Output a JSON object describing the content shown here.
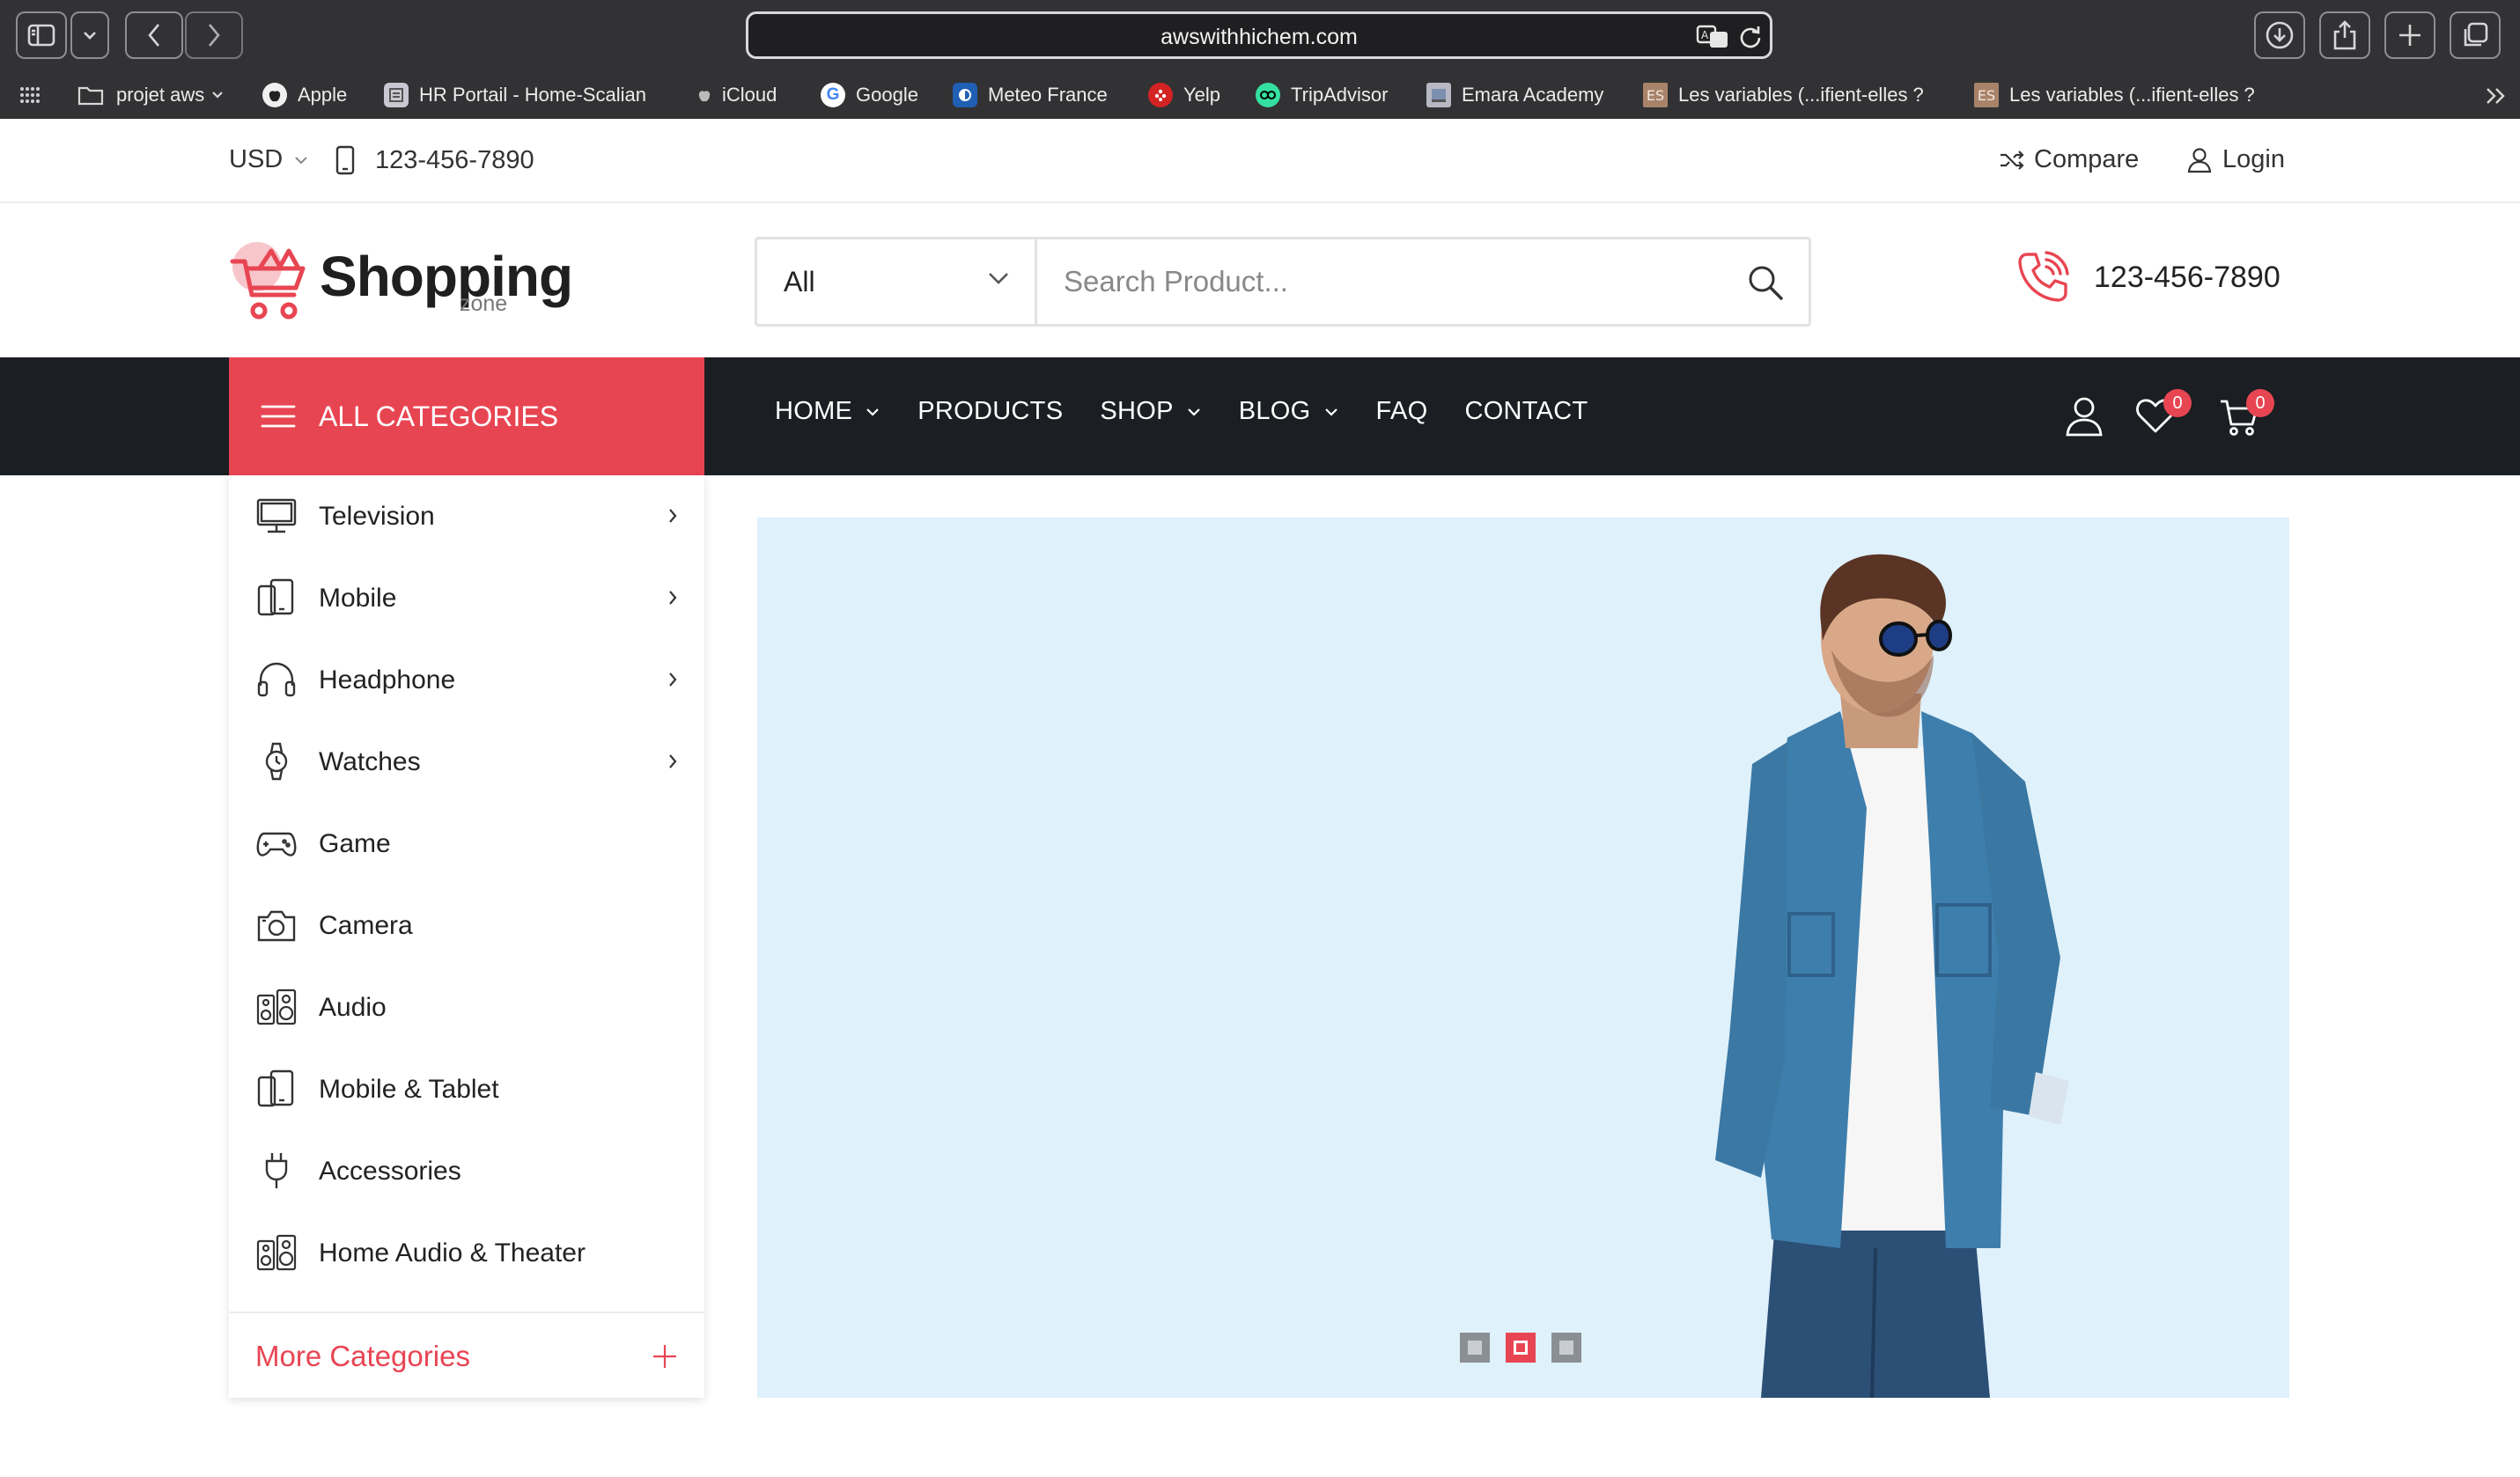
{
  "browser": {
    "url": "awswithhichem.com",
    "bookmarks": [
      {
        "label": "projet aws",
        "icon": "folder-icon"
      },
      {
        "label": "Apple",
        "icon": "apple-icon"
      },
      {
        "label": "HR Portail - Home-Scalian",
        "icon": "hr-portal-icon"
      },
      {
        "label": "iCloud",
        "icon": "apple-icon"
      },
      {
        "label": "Google",
        "icon": "google-icon"
      },
      {
        "label": "Meteo France",
        "icon": "meteo-icon"
      },
      {
        "label": "Yelp",
        "icon": "yelp-icon"
      },
      {
        "label": "TripAdvisor",
        "icon": "tripadvisor-icon"
      },
      {
        "label": "Emara Academy",
        "icon": "emara-icon"
      },
      {
        "label": "Les variables (...ifient-elles ?",
        "icon": "es-icon",
        "icon_text": "ES"
      },
      {
        "label": "Les variables (...ifient-elles ?",
        "icon": "es-icon",
        "icon_text": "ES"
      }
    ]
  },
  "topbar": {
    "currency": "USD",
    "phone": "123-456-7890",
    "compare": "Compare",
    "login": "Login"
  },
  "header": {
    "logo_main": "Shopping",
    "logo_sub": "zone",
    "category_select": "All",
    "search_placeholder": "Search Product...",
    "phone": "123-456-7890"
  },
  "nav": {
    "all_categories": "ALL CATEGORIES",
    "menu": [
      {
        "label": "HOME",
        "dropdown": true
      },
      {
        "label": "PRODUCTS",
        "dropdown": false
      },
      {
        "label": "SHOP",
        "dropdown": true
      },
      {
        "label": "BLOG",
        "dropdown": true
      },
      {
        "label": "FAQ",
        "dropdown": false
      },
      {
        "label": "CONTACT",
        "dropdown": false
      }
    ],
    "wishlist_count": "0",
    "cart_count": "0"
  },
  "sidebar": {
    "categories": [
      {
        "label": "Television",
        "icon": "television-icon",
        "has_submenu": true
      },
      {
        "label": "Mobile",
        "icon": "mobile-icon",
        "has_submenu": true
      },
      {
        "label": "Headphone",
        "icon": "headphone-icon",
        "has_submenu": true
      },
      {
        "label": "Watches",
        "icon": "watch-icon",
        "has_submenu": true
      },
      {
        "label": "Game",
        "icon": "gamepad-icon",
        "has_submenu": false
      },
      {
        "label": "Camera",
        "icon": "camera-icon",
        "has_submenu": false
      },
      {
        "label": "Audio",
        "icon": "speaker-icon",
        "has_submenu": false
      },
      {
        "label": "Mobile & Tablet",
        "icon": "tablet-icon",
        "has_submenu": false
      },
      {
        "label": "Accessories",
        "icon": "plug-icon",
        "has_submenu": false
      },
      {
        "label": "Home Audio & Theater",
        "icon": "speaker-icon",
        "has_submenu": false
      }
    ],
    "more": "More Categories"
  },
  "banner": {
    "slide_count": 3,
    "active_slide": 2
  },
  "colors": {
    "accent": "#e84552",
    "nav_bg": "#1b1e22",
    "banner_bg": "#dff1fb",
    "chrome_bg": "#323234"
  }
}
